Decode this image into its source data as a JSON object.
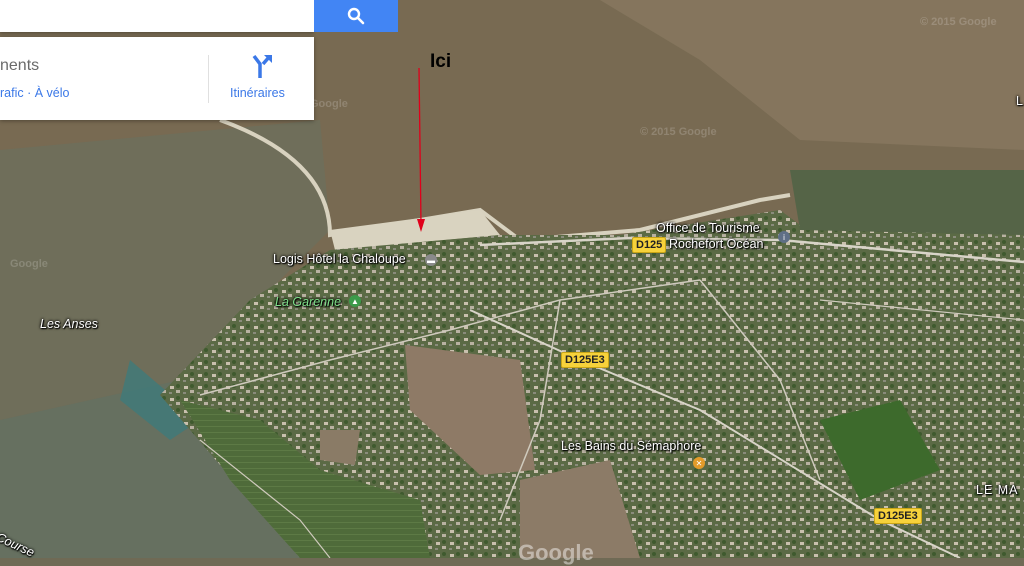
{
  "search": {
    "button_icon": "search-icon"
  },
  "panel": {
    "title_partial": "nents",
    "subtitle_partial": "rafic · À vélo",
    "directions_label": "Itinéraires",
    "directions_icon": "directions-icon"
  },
  "annotation": {
    "label": "Ici",
    "arrow_color": "#e0001b"
  },
  "places": {
    "office": "Office de Tourisme",
    "office2": "Rochefort Océan",
    "hotel": "Logis Hôtel la Chaloupe",
    "garenne": "La Garenne",
    "anses": "Les Anses",
    "bains": "Les Bains du Sémaphore",
    "lema": "LE MA",
    "course": "Course",
    "edge_l": "L"
  },
  "roads": {
    "d125": "D125",
    "d125e3_a": "D125E3",
    "d125e3_b": "D125E3"
  },
  "watermarks": {
    "google": "Google",
    "copyright1": "© 2015 Google",
    "copyright2": "© 2015 Google",
    "bottom": "Google"
  },
  "colors": {
    "accent": "#4285f4",
    "link": "#3b78e7",
    "road_shield": "#f7d23b"
  }
}
